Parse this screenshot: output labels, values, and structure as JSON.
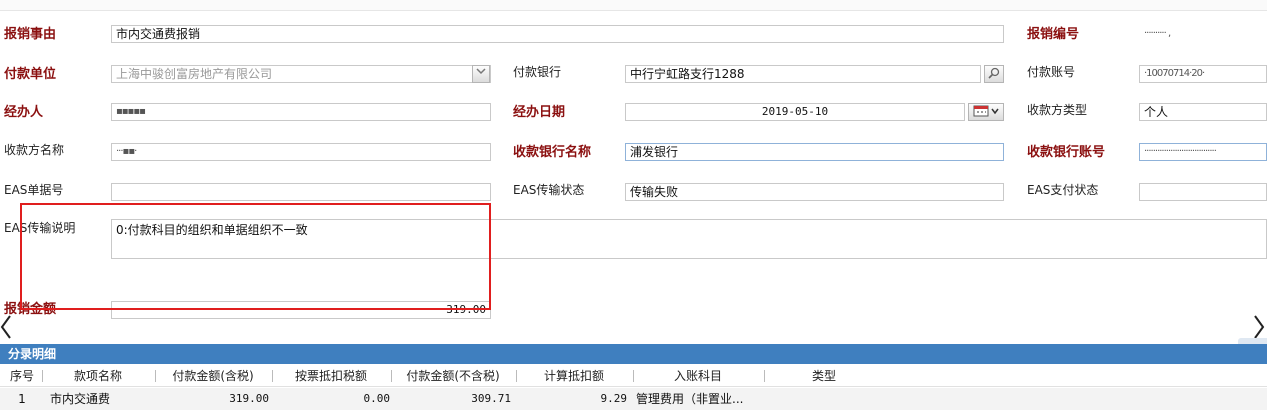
{
  "form": {
    "reason_label": "报销事由",
    "reason_value": "市内交通费报销",
    "number_label": "报销编号",
    "number_value": "··········  ,",
    "payer_unit_label": "付款单位",
    "payer_unit_value": "上海中骏创富房地产有限公司",
    "pay_bank_label": "付款银行",
    "pay_bank_value": "中行宁虹路支行1288",
    "pay_account_label": "付款账号",
    "pay_account_value": "·10070714·20·",
    "handler_label": "经办人",
    "handler_value": "▪▪▪▪▪",
    "handle_date_label": "经办日期",
    "handle_date_value": "2019-05-10",
    "payee_type_label": "收款方类型",
    "payee_type_value": "个人",
    "payee_name_label": "收款方名称",
    "payee_name_value": "···▪▪·",
    "payee_bank_label": "收款银行名称",
    "payee_bank_value": "浦发银行",
    "payee_account_label": "收款银行账号",
    "payee_account_value": "·································",
    "eas_no_label": "EAS单据号",
    "eas_no_value": "",
    "eas_status_label": "EAS传输状态",
    "eas_status_value": "传输失败",
    "eas_pay_label": "EAS支付状态",
    "eas_pay_value": "",
    "eas_desc_label": "EAS传输说明",
    "eas_desc_value": "0:付款科目的组织和单据组织不一致",
    "amount_label": "报销金额",
    "amount_value": "319.00"
  },
  "icons": {
    "dropdown": "chevron-down",
    "lookup": "magnifier",
    "calendar": "calendar",
    "prev": "‹",
    "next": "›"
  },
  "colors": {
    "required_label": "#8b1010",
    "section_bar": "#3f7fbf",
    "highlight_box": "#e01e1e"
  },
  "detail": {
    "section_title": "分录明细",
    "columns": [
      "序号",
      "款项名称",
      "付款金额(含税)",
      "按票抵扣税额",
      "付款金额(不含税)",
      "计算抵扣额",
      "入账科目",
      "类型"
    ],
    "rows": [
      {
        "index": "1",
        "item": "市内交通费",
        "amount_tax": "319.00",
        "deduct_tax": "0.00",
        "amount_notax": "309.71",
        "calc_deduct": "9.29",
        "account": "管理费用（非置业...",
        "type": ""
      }
    ]
  }
}
